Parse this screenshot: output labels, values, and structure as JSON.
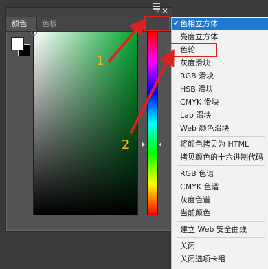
{
  "panel": {
    "tabs": [
      {
        "label": "颜色"
      },
      {
        "label": "色板"
      }
    ]
  },
  "menu": {
    "items": [
      {
        "label": "色相立方体",
        "checked": true
      },
      {
        "label": "亮度立方体"
      },
      {
        "label": "色轮"
      },
      {
        "label": "灰度滑块"
      },
      {
        "label": "RGB 滑块"
      },
      {
        "label": "HSB 滑块"
      },
      {
        "label": "CMYK 滑块"
      },
      {
        "label": "Lab 滑块"
      },
      {
        "label": "Web 颜色滑块"
      },
      {
        "label": "将颜色拷贝为 HTML"
      },
      {
        "label": "拷贝颜色的十六进制代码"
      },
      {
        "label": "RGB 色谱"
      },
      {
        "label": "CMYK 色谱"
      },
      {
        "label": "灰度色谱"
      },
      {
        "label": "当前颜色"
      },
      {
        "label": "建立 Web 安全曲线"
      },
      {
        "label": "关闭"
      },
      {
        "label": "关闭选项卡组"
      }
    ]
  },
  "annotations": {
    "step1": "1",
    "step2": "2"
  },
  "colors": {
    "foreground": "#ffffff",
    "background": "#000000",
    "field_hue": "#00a52e",
    "highlight": "#e0201f",
    "arrow": "#e0201f",
    "step_number": "#f3c21a",
    "menu_selected": "#1e79d3"
  }
}
